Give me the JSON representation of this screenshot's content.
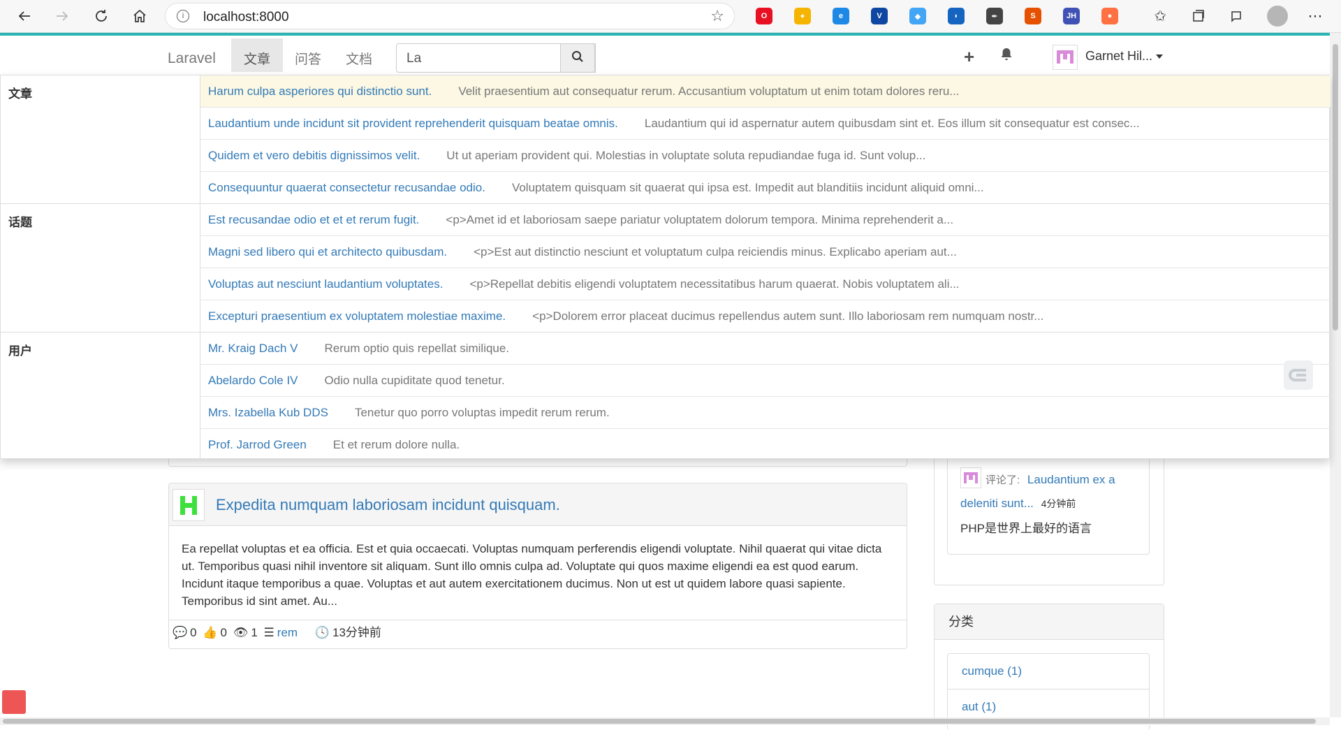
{
  "browser": {
    "url": "localhost:8000",
    "extensions": [
      {
        "name": "opera-icon",
        "color": "#e81123",
        "glyph": "O"
      },
      {
        "name": "pinwheel-icon",
        "color": "#f4b400",
        "glyph": "✦"
      },
      {
        "name": "edge-ext-icon",
        "color": "#1e88e5",
        "glyph": "e"
      },
      {
        "name": "v-ext-icon",
        "color": "#0d47a1",
        "glyph": "V"
      },
      {
        "name": "compass-ext-icon",
        "color": "#42a5f5",
        "glyph": "◆"
      },
      {
        "name": "shield-ext-icon",
        "color": "#1565c0",
        "glyph": "◗"
      },
      {
        "name": "dropper-ext-icon",
        "color": "#444",
        "glyph": "✒"
      },
      {
        "name": "sprout-ext-icon",
        "color": "#e65100",
        "glyph": "S"
      },
      {
        "name": "jh-ext-icon",
        "color": "#3f51b5",
        "glyph": "JH"
      },
      {
        "name": "circle-ext-icon",
        "color": "#ff7043",
        "glyph": "●"
      }
    ]
  },
  "nav": {
    "brand": "Laravel",
    "links": [
      "文章",
      "问答",
      "文档"
    ],
    "active_index": 0,
    "search_value": "La",
    "user_name": "Garnet Hil..."
  },
  "dropdown": {
    "groups": [
      {
        "label": "文章",
        "rows": [
          {
            "title": "Harum culpa asperiores qui distinctio sunt.",
            "desc": "Velit praesentium aut consequatur rerum. Accusantium voluptatum ut enim totam dolores reru..."
          },
          {
            "title": "Laudantium unde incidunt sit provident reprehenderit quisquam beatae omnis.",
            "desc": "Laudantium qui id aspernatur autem quibusdam sint et. Eos illum sit consequatur est consec..."
          },
          {
            "title": "Quidem et vero debitis dignissimos velit.",
            "desc": "Ut ut aperiam provident qui. Molestias in voluptate soluta repudiandae fuga id. Sunt volup..."
          },
          {
            "title": "Consequuntur quaerat consectetur recusandae odio.",
            "desc": "Voluptatem quisquam sit quaerat qui ipsa est. Impedit aut blanditiis incidunt aliquid omni..."
          }
        ]
      },
      {
        "label": "话题",
        "rows": [
          {
            "title": "Est recusandae odio et et et rerum fugit.",
            "desc": "<p>Amet id et laboriosam saepe pariatur voluptatem dolorum tempora. Minima reprehenderit a..."
          },
          {
            "title": "Magni sed libero qui et architecto quibusdam.",
            "desc": "<p>Est aut distinctio nesciunt et voluptatum culpa reiciendis minus. Explicabo aperiam aut..."
          },
          {
            "title": "Voluptas aut nesciunt laudantium voluptates.",
            "desc": "<p>Repellat debitis eligendi voluptatem necessitatibus harum quaerat. Nobis voluptatem ali..."
          },
          {
            "title": "Excepturi praesentium ex voluptatem molestiae maxime.",
            "desc": "<p>Dolorem error placeat ducimus repellendus autem sunt. Illo laboriosam rem numquam nostr..."
          }
        ]
      },
      {
        "label": "用户",
        "rows": [
          {
            "title": "Mr. Kraig Dach V",
            "desc": "Rerum optio quis repellat similique."
          },
          {
            "title": "Abelardo Cole IV",
            "desc": "Odio nulla cupiditate quod tenetur."
          },
          {
            "title": "Mrs. Izabella Kub DDS",
            "desc": "Tenetur quo porro voluptas impedit rerum rerum."
          },
          {
            "title": "Prof. Jarrod Green",
            "desc": "Et et rerum dolore nulla."
          }
        ]
      }
    ]
  },
  "post": {
    "title": "Expedita numquam laboriosam incidunt quisquam.",
    "body": "Ea repellat voluptas et ea officia. Est et quia occaecati. Voluptas numquam perferendis eligendi voluptate. Nihil quaerat qui vitae dicta ut. Temporibus quasi nihil inventore sit aliquam. Sunt illo omnis culpa ad. Voluptate qui quos maxime eligendi ea est quod earum. Incidunt itaque temporibus a quae. Voluptas et aut autem exercitationem ducimus. Non ut est ut quidem labore quasi sapiente. Temporibus id sint amet. Au...",
    "comments": "0",
    "likes": "0",
    "views": "1",
    "category": "rem",
    "time": "13分钟前"
  },
  "sidebar": {
    "activity": {
      "action": "评论了:",
      "link": "Laudantium ex a deleniti sunt...",
      "time": "4分钟前",
      "comment": "PHP是世界上最好的语言"
    },
    "categories_title": "分类",
    "categories": [
      "cumque (1)",
      "aut (1)"
    ]
  }
}
